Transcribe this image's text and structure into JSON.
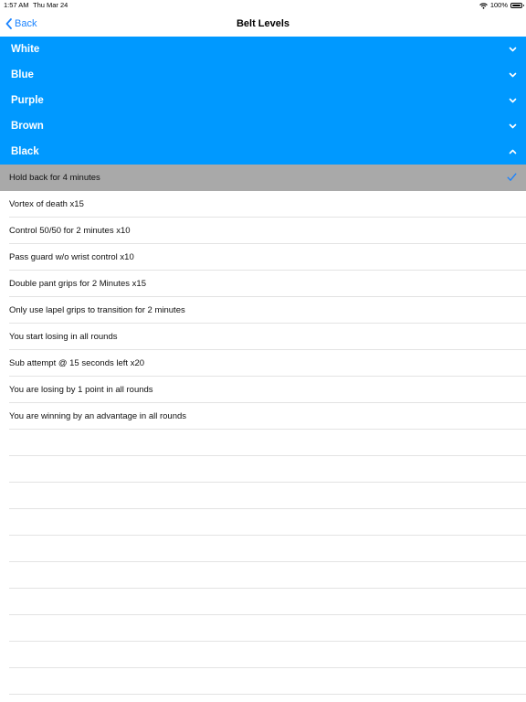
{
  "status": {
    "time": "1:57 AM",
    "date": "Thu Mar 24",
    "battery": "100%"
  },
  "nav": {
    "back_label": "Back",
    "title": "Belt Levels"
  },
  "belts": [
    {
      "label": "White",
      "expanded": false
    },
    {
      "label": "Blue",
      "expanded": false
    },
    {
      "label": "Purple",
      "expanded": false
    },
    {
      "label": "Brown",
      "expanded": false
    },
    {
      "label": "Black",
      "expanded": true
    }
  ],
  "tasks": [
    {
      "label": "Hold back for 4 minutes",
      "selected": true
    },
    {
      "label": "Vortex of death x15"
    },
    {
      "label": "Control 50/50 for 2 minutes x10"
    },
    {
      "label": "Pass guard w/o wrist control x10"
    },
    {
      "label": "Double pant grips for 2 Minutes x15"
    },
    {
      "label": "Only use lapel grips to transition for 2 minutes"
    },
    {
      "label": "You start losing in all rounds"
    },
    {
      "label": "Sub attempt @ 15 seconds left x20"
    },
    {
      "label": "You are losing by 1 point in all rounds"
    },
    {
      "label": "You are winning by an advantage in all rounds"
    }
  ],
  "colors": {
    "accent": "#0099ff",
    "link": "#1a83ff",
    "selected_row": "#a9a9a9"
  }
}
